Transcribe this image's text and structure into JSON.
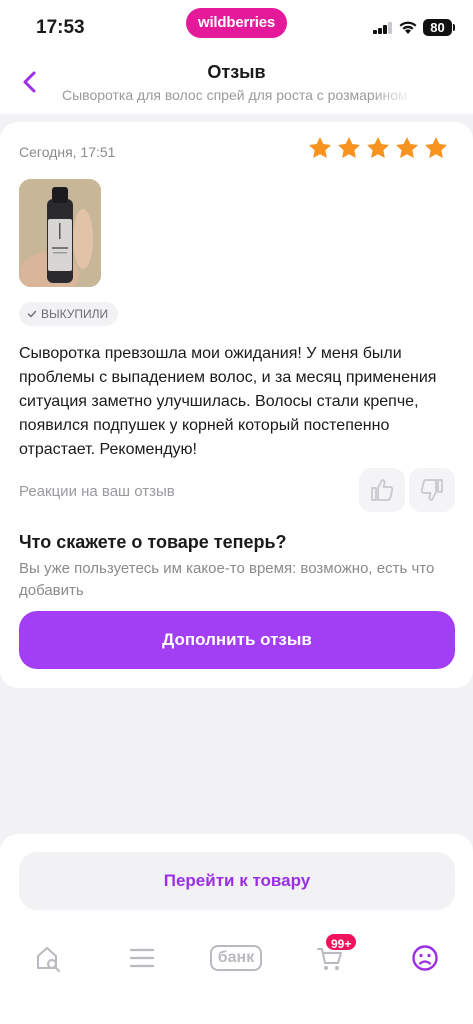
{
  "status_bar": {
    "time": "17:53",
    "logo": "wildberries",
    "battery": "80"
  },
  "header": {
    "title": "Отзыв",
    "subtitle": "Сыворотка для волос спрей для роста с розмарином",
    "back_icon": "chevron-left-icon"
  },
  "review": {
    "date": "Сегодня, 17:51",
    "rating": 5,
    "rating_max": 5,
    "star_color": "#f7931e",
    "badge": "выкупили",
    "text": "Сыворотка превзошла мои ожидания! У меня были проблемы с выпадением волос, и за месяц применения ситуация заметно улучшилась. Волосы стали крепче, появился подпушек у корней который постепенно отрастает. Рекомендую!",
    "reactions_label": "Реакции на ваш отзыв"
  },
  "followup": {
    "question": "Что скажете о товаре теперь?",
    "hint": "Вы уже пользуетесь им какое-то время: возможно, есть что добавить",
    "button": "Дополнить отзыв"
  },
  "bottom": {
    "go_to_product": "Перейти к товару",
    "tabs": [
      "home-search-icon",
      "menu-icon",
      "bank-icon",
      "cart-icon",
      "profile-icon"
    ],
    "bank_label": "банк",
    "cart_badge": "99+"
  },
  "colors": {
    "accent": "#a23ef3",
    "brand": "#e51a9a",
    "badge": "#f0125a"
  }
}
